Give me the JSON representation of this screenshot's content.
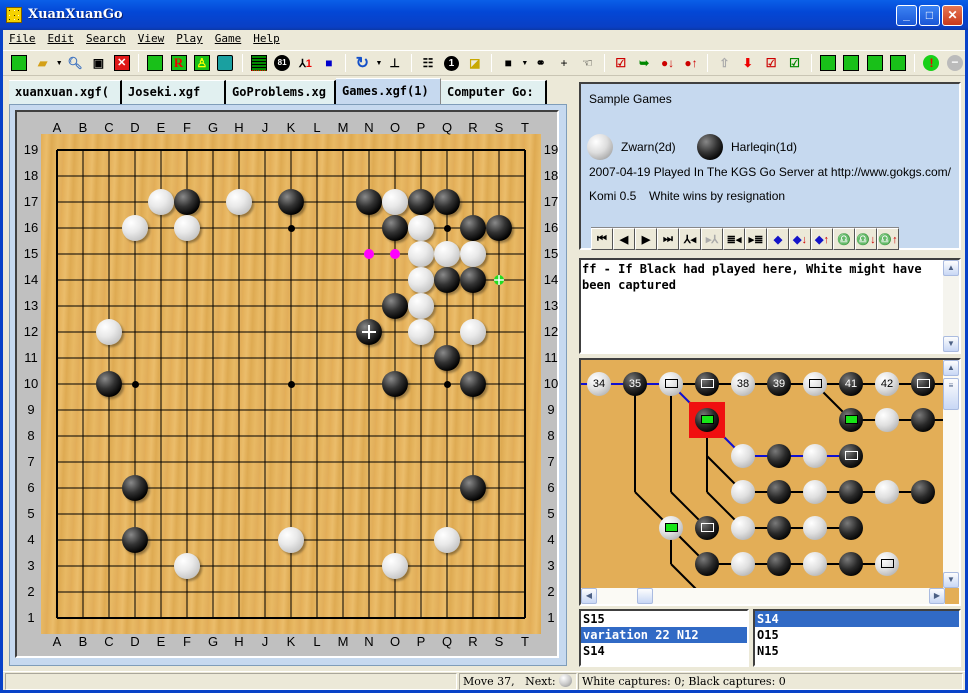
{
  "window": {
    "title": "XuanXuanGo"
  },
  "menu": [
    "File",
    "Edit",
    "Search",
    "View",
    "Play",
    "Game",
    "Help"
  ],
  "toolbar": {
    "buttons": [
      "new-game",
      "open",
      "find",
      "save",
      "close",
      "board-view",
      "review",
      "play-mode",
      "display",
      "grid",
      "move-number",
      "label",
      "mark-tool",
      "rotate",
      "coordinates",
      "properties",
      "info",
      "eraser",
      "stone-black",
      "connect",
      "cross",
      "hand",
      "comment",
      "next-variation",
      "next-mark-down",
      "next-mark-up",
      "home",
      "down",
      "check",
      "check-list",
      "red-tool",
      "yellow-tool",
      "loop-tool",
      "panda-tool",
      "alert",
      "stop"
    ]
  },
  "tabs": [
    {
      "label": "xuanxuan.xgf(",
      "active": false
    },
    {
      "label": "Joseki.xgf",
      "active": false
    },
    {
      "label": "GoProblems.xg",
      "active": false
    },
    {
      "label": "Games.xgf(1)",
      "active": true
    },
    {
      "label": "Computer Go:",
      "active": false
    }
  ],
  "board": {
    "size": 19,
    "columns": [
      "A",
      "B",
      "C",
      "D",
      "E",
      "F",
      "G",
      "H",
      "J",
      "K",
      "L",
      "M",
      "N",
      "O",
      "P",
      "Q",
      "R",
      "S",
      "T"
    ],
    "rows": [
      "19",
      "18",
      "17",
      "16",
      "15",
      "14",
      "13",
      "12",
      "11",
      "10",
      "9",
      "8",
      "7",
      "6",
      "5",
      "4",
      "3",
      "2",
      "1"
    ],
    "hoshi": [
      "D16",
      "K16",
      "Q16",
      "D10",
      "K10",
      "Q10",
      "D4",
      "K4",
      "Q4"
    ],
    "stones": [
      {
        "pos": "E17",
        "color": "white"
      },
      {
        "pos": "F17",
        "color": "black"
      },
      {
        "pos": "H17",
        "color": "white"
      },
      {
        "pos": "K17",
        "color": "black"
      },
      {
        "pos": "D16",
        "color": "white"
      },
      {
        "pos": "F16",
        "color": "white"
      },
      {
        "pos": "N17",
        "color": "black"
      },
      {
        "pos": "O17",
        "color": "white"
      },
      {
        "pos": "P17",
        "color": "black"
      },
      {
        "pos": "Q17",
        "color": "black"
      },
      {
        "pos": "O16",
        "color": "black"
      },
      {
        "pos": "P16",
        "color": "white"
      },
      {
        "pos": "R16",
        "color": "black"
      },
      {
        "pos": "S16",
        "color": "black"
      },
      {
        "pos": "P15",
        "color": "white"
      },
      {
        "pos": "Q15",
        "color": "white"
      },
      {
        "pos": "R15",
        "color": "white"
      },
      {
        "pos": "P14",
        "color": "white"
      },
      {
        "pos": "Q14",
        "color": "black"
      },
      {
        "pos": "R14",
        "color": "black"
      },
      {
        "pos": "O13",
        "color": "black"
      },
      {
        "pos": "P13",
        "color": "white"
      },
      {
        "pos": "C12",
        "color": "white"
      },
      {
        "pos": "N12",
        "color": "black",
        "marker": "last-move"
      },
      {
        "pos": "P12",
        "color": "white"
      },
      {
        "pos": "R12",
        "color": "white"
      },
      {
        "pos": "Q11",
        "color": "black"
      },
      {
        "pos": "C10",
        "color": "black"
      },
      {
        "pos": "O10",
        "color": "black"
      },
      {
        "pos": "R10",
        "color": "black"
      },
      {
        "pos": "D6",
        "color": "black"
      },
      {
        "pos": "R6",
        "color": "black"
      },
      {
        "pos": "D4",
        "color": "black"
      },
      {
        "pos": "K4",
        "color": "white"
      },
      {
        "pos": "Q4",
        "color": "white"
      },
      {
        "pos": "F3",
        "color": "white"
      },
      {
        "pos": "O3",
        "color": "white"
      }
    ],
    "marks": [
      {
        "pos": "N15",
        "type": "dot",
        "color": "#ff00ff"
      },
      {
        "pos": "O15",
        "type": "dot",
        "color": "#ff00ff"
      },
      {
        "pos": "S14",
        "type": "cross-dot",
        "color": "#22dd22"
      }
    ]
  },
  "game_info": {
    "title": "Sample Games",
    "white_player": "Zwarn(2d)",
    "black_player": "Harleqin(1d)",
    "event": "2007-04-19 Played In The KGS Go Server at http://www.gokgs.com/",
    "komi": "Komi 0.5",
    "result": "White wins by resignation"
  },
  "nav_buttons": [
    "first",
    "prev",
    "next",
    "last",
    "branch-back",
    "branch-forward",
    "prev-comment",
    "next-comment",
    "mark",
    "mark-down",
    "mark-up",
    "search",
    "search-down",
    "search-up"
  ],
  "comment": "ff - If Black had played here, White might have been captured",
  "tree": {
    "main_line": [
      {
        "label": "34",
        "color": "white"
      },
      {
        "label": "35",
        "color": "black"
      },
      {
        "label": "",
        "color": "white",
        "icon": "envelope"
      },
      {
        "label": "",
        "color": "black",
        "icon": "envelope"
      },
      {
        "label": "38",
        "color": "white"
      },
      {
        "label": "39",
        "color": "black"
      },
      {
        "label": "",
        "color": "white",
        "icon": "envelope"
      },
      {
        "label": "41",
        "color": "black"
      },
      {
        "label": "42",
        "color": "white"
      },
      {
        "label": "",
        "color": "black",
        "icon": "envelope"
      }
    ]
  },
  "variation_list": [
    {
      "label": "S15",
      "selected": false
    },
    {
      "label": "variation 22 N12",
      "selected": true
    },
    {
      "label": "S14",
      "selected": false
    }
  ],
  "candidate_list": [
    {
      "label": "S14",
      "selected": true
    },
    {
      "label": "O15",
      "selected": false
    },
    {
      "label": "N15",
      "selected": false
    }
  ],
  "status": {
    "move": "Move 37,",
    "next_label": "Next:",
    "next_color": "white",
    "captures": "White captures: 0; Black captures: 0"
  }
}
